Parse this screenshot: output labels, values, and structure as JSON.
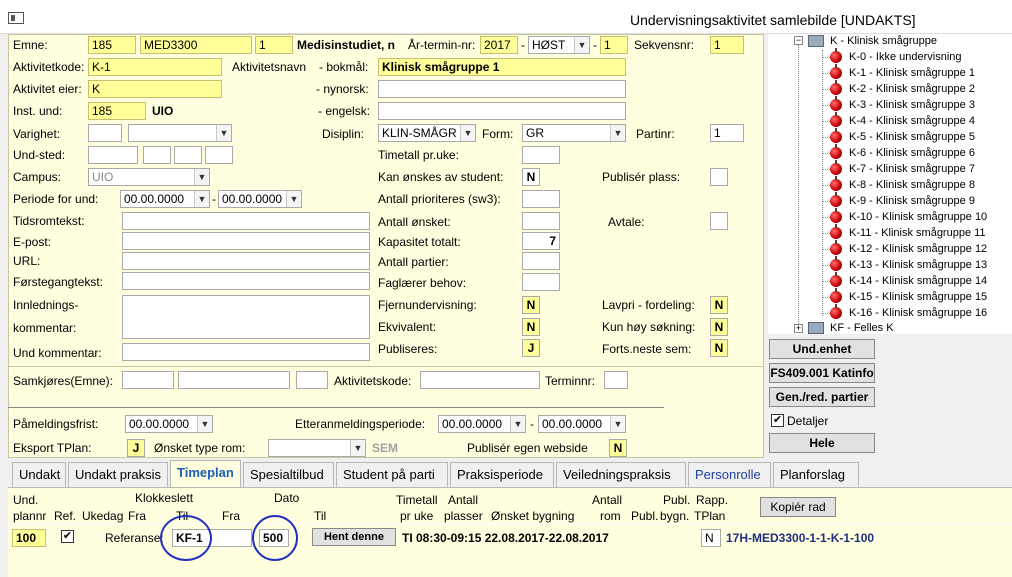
{
  "window": {
    "title": "Undervisningsaktivitet samlebilde  [UNDAKTS]"
  },
  "form": {
    "emne_label": "Emne:",
    "emne_inst": "185",
    "emne_code": "MED3300",
    "emne_ver": "1",
    "emne_name": "Medisinstudiet, n",
    "ar_termin_label": "År-termin-nr:",
    "ar": "2017",
    "termin": "HØST",
    "termin_nr": "1",
    "sekvensnr_label": "Sekvensnr:",
    "sekvensnr": "1",
    "aktivitetkode_label": "Aktivitetkode:",
    "aktivitetkode": "K-1",
    "aktivitetsnavn_label": "Aktivitetsnavn",
    "bokmal_label": "- bokmål:",
    "bokmal": "Klinisk smågruppe 1",
    "aktivitet_eier_label": "Aktivitet eier:",
    "aktivitet_eier": "K",
    "nynorsk_label": "- nynorsk:",
    "inst_und_label": "Inst. und:",
    "inst_und": "185",
    "inst_und_name": "UIO",
    "engelsk_label": "- engelsk:",
    "varighet_label": "Varighet:",
    "disiplin_label": "Disiplin:",
    "disiplin": "KLIN-SMÅGR",
    "form_label": "Form:",
    "form_value": "GR",
    "partinr_label": "Partinr:",
    "partinr": "1",
    "und_sted_label": "Und-sted:",
    "timetall_label": "Timetall pr.uke:",
    "campus_label": "Campus:",
    "campus": "UIO",
    "kan_onskes_label": "Kan ønskes av student:",
    "kan_onskes": "N",
    "publiser_plass_label": "Publisér plass:",
    "periode_label": "Periode for und:",
    "periode_fra": "00.00.0000",
    "periode_til": "00.00.0000",
    "antall_prioriteres_label": "Antall prioriteres (sw3):",
    "tidsromtekst_label": "Tidsromtekst:",
    "antall_onsket_label": "Antall ønsket:",
    "avtale_label": "Avtale:",
    "epost_label": "E-post:",
    "kapasitet_label": "Kapasitet totalt:",
    "kapasitet": "7",
    "url_label": "URL:",
    "antall_partier_label": "Antall partier:",
    "forstegangtekst_label": "Førstegangtekst:",
    "faglaerer_label": "Faglærer behov:",
    "innlednings_label1": "Innlednings-",
    "innlednings_label2": "kommentar:",
    "fjernund_label": "Fjernundervisning:",
    "fjernund": "N",
    "lavpri_label": "Lavpri - fordeling:",
    "lavpri": "N",
    "ekvivalent_label": "Ekvivalent:",
    "ekvivalent": "N",
    "kun_hoy_label": "Kun høy søkning:",
    "kun_hoy": "N",
    "und_kommentar_label": "Und kommentar:",
    "publiseres_label": "Publiseres:",
    "publiseres": "J",
    "forts_label": "Forts.neste sem:",
    "forts": "N",
    "samkjores_label": "Samkjøres(Emne):",
    "aktivitetskode2_label": "Aktivitetskode:",
    "terminnr_label": "Terminnr:",
    "pameldingsfrist_label": "Påmeldingsfrist:",
    "pameldingsfrist": "00.00.0000",
    "etteranmelding_label": "Etteranmeldingsperiode:",
    "etteranmelding_fra": "00.00.0000",
    "etteranmelding_til": "00.00.0000",
    "eksport_label": "Eksport TPlan:",
    "eksport": "J",
    "onsket_rom_label": "Ønsket type rom:",
    "sem_label": "SEM",
    "publiser_web_label": "Publisér egen webside",
    "publiser_web": "N"
  },
  "tree": {
    "root": "K - Klinisk smågruppe",
    "items": [
      "K-0 - Ikke undervisning",
      "K-1 - Klinisk smågruppe 1",
      "K-2 - Klinisk smågruppe 2",
      "K-3 - Klinisk smågruppe 3",
      "K-4 - Klinisk smågruppe 4",
      "K-5 - Klinisk smågruppe 5",
      "K-6 - Klinisk smågruppe 6",
      "K-7 - Klinisk smågruppe 7",
      "K-8 - Klinisk smågruppe 8",
      "K-9 - Klinisk smågruppe 9",
      "K-10 - Klinisk smågruppe 10",
      "K-11 - Klinisk smågruppe 11",
      "K-12 - Klinisk smågruppe 12",
      "K-13 - Klinisk smågruppe 13",
      "K-14 - Klinisk smågruppe 14",
      "K-15 - Klinisk smågruppe 15",
      "K-16 - Klinisk smågruppe 16"
    ],
    "next_root": "KF - Felles K"
  },
  "side_buttons": {
    "und_enhet": "Und.enhet",
    "katinfo": "FS409.001 Katinfo",
    "gen_red": "Gen./red. partier",
    "detaljer": "Detaljer",
    "hele": "Hele"
  },
  "tabs": [
    "Undakt",
    "Undakt praksis",
    "Timeplan",
    "Spesialtilbud",
    "Student på parti",
    "Praksisperiode",
    "Veiledningspraksis",
    "Personrolle",
    "Planforslag"
  ],
  "timeplan": {
    "headers": {
      "und": "Und.",
      "plannr": "plannr",
      "ref": "Ref.",
      "ukedag": "Ukedag",
      "klokkeslett": "Klokkeslett",
      "fra": "Fra",
      "til": "Til",
      "fra2": "Fra",
      "dato": "Dato",
      "til2": "Til",
      "timetall": "Timetall",
      "pr_uke": "pr uke",
      "antall": "Antall",
      "plasser": "plasser",
      "onsket_bygning": "Ønsket bygning",
      "antall_rom": "Antall",
      "rom": "rom",
      "publ": "Publ.",
      "publ2": "Publ.",
      "bygn": "bygn.",
      "rapp": "Rapp.",
      "tplan": "TPlan"
    },
    "kopier_btn": "Kopiér rad",
    "row": {
      "plannr": "100",
      "referanse_label": "Referanse:",
      "referanse": "KF-1",
      "ref_nr": "500",
      "hent_btn": "Hent denne",
      "summary": "TI 08:30-09:15 22.08.2017-22.08.2017",
      "rapp": "N",
      "code": "17H-MED3300-1-1-K-1-100"
    }
  }
}
